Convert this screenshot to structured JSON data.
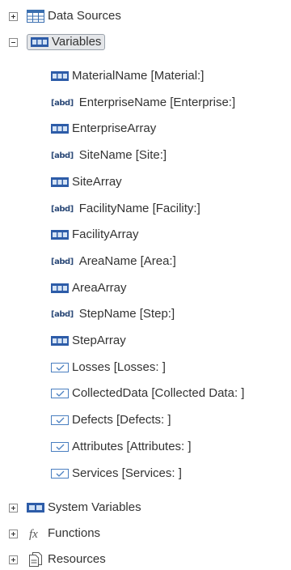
{
  "tree": {
    "data_sources": "Data Sources",
    "variables": "Variables",
    "children": [
      {
        "label": "MaterialName [Material:]",
        "icon": "grid-variable-icon"
      },
      {
        "label": "EnterpriseName [Enterprise:]",
        "icon": "text-variable-icon"
      },
      {
        "label": "EnterpriseArray",
        "icon": "grid-variable-icon"
      },
      {
        "label": "SiteName [Site:]",
        "icon": "text-variable-icon"
      },
      {
        "label": "SiteArray",
        "icon": "grid-variable-icon"
      },
      {
        "label": "FacilityName [Facility:]",
        "icon": "text-variable-icon"
      },
      {
        "label": "FacilityArray",
        "icon": "grid-variable-icon"
      },
      {
        "label": "AreaName [Area:]",
        "icon": "text-variable-icon"
      },
      {
        "label": "AreaArray",
        "icon": "grid-variable-icon"
      },
      {
        "label": "StepName [Step:]",
        "icon": "text-variable-icon"
      },
      {
        "label": "StepArray",
        "icon": "grid-variable-icon"
      },
      {
        "label": "Losses [Losses: ]",
        "icon": "checkbox-variable-icon"
      },
      {
        "label": "CollectedData [Collected Data: ]",
        "icon": "checkbox-variable-icon"
      },
      {
        "label": "Defects [Defects: ]",
        "icon": "checkbox-variable-icon"
      },
      {
        "label": "Attributes [Attributes: ]",
        "icon": "checkbox-variable-icon"
      },
      {
        "label": "Services [Services: ]",
        "icon": "checkbox-variable-icon"
      }
    ],
    "system_variables": "System Variables",
    "functions": "Functions",
    "resources": "Resources",
    "text_icon_glyph": "[abd]"
  }
}
